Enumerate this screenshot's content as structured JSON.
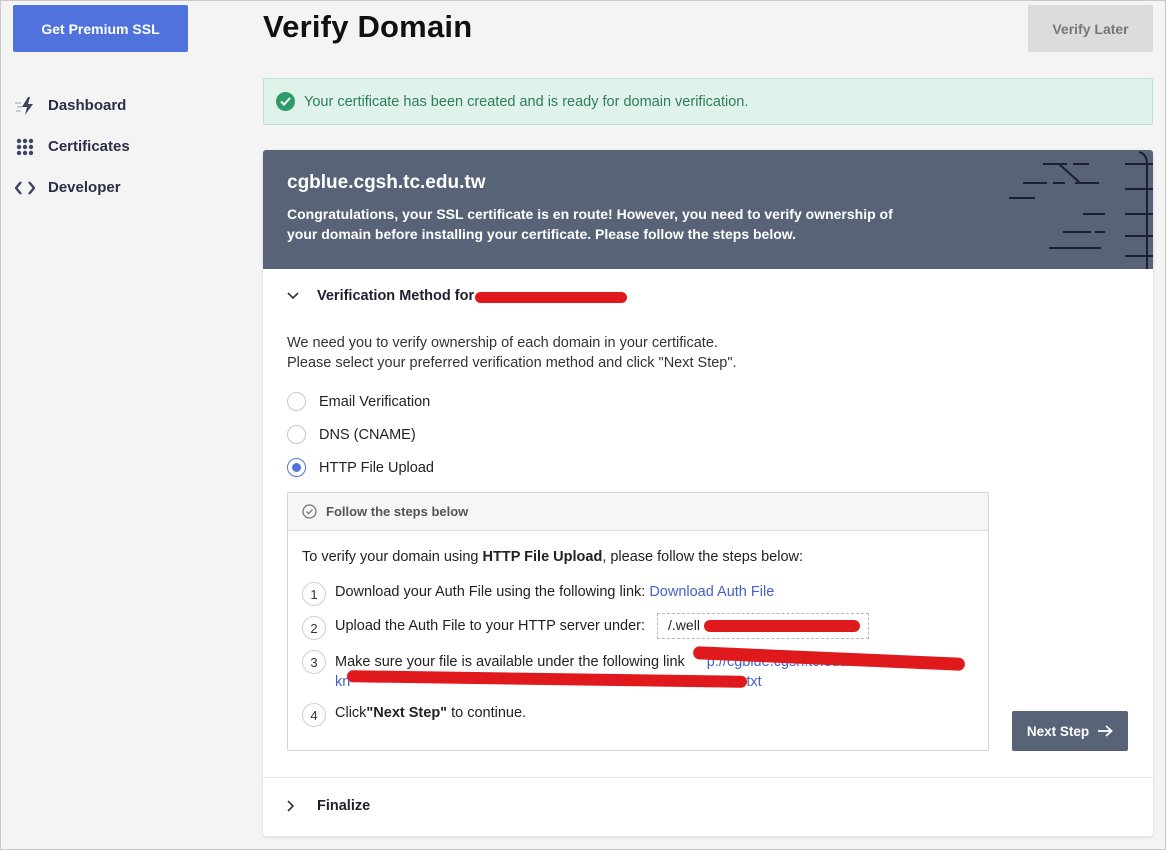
{
  "sidebar": {
    "premium_button": "Get Premium SSL",
    "items": [
      {
        "label": "Dashboard",
        "icon": "bolt-icon"
      },
      {
        "label": "Certificates",
        "icon": "grid-icon"
      },
      {
        "label": "Developer",
        "icon": "code-icon"
      }
    ]
  },
  "header": {
    "title": "Verify Domain",
    "verify_later": "Verify Later"
  },
  "banner": {
    "text": "Your certificate has been created and is ready for domain verification.",
    "color": "#2e7d5b"
  },
  "card": {
    "domain": "cgblue.cgsh.tc.edu.tw",
    "congrats": "Congratulations, your SSL certificate is en route! However, you need to verify ownership of your domain before installing your certificate. Please follow the steps below.",
    "method_section": "Verification Method for",
    "intro_line1": "We need you to verify ownership of each domain in your certificate.",
    "intro_line2": "Please select your preferred verification method and click \"Next Step\".",
    "methods": [
      {
        "label": "Email Verification",
        "selected": false
      },
      {
        "label": "DNS (CNAME)",
        "selected": false
      },
      {
        "label": "HTTP File Upload",
        "selected": true
      }
    ],
    "steps": {
      "header": "Follow the steps below",
      "intro_prefix": "To verify your domain using ",
      "intro_bold": "HTTP File Upload",
      "intro_suffix": ", please follow the steps below:",
      "step1_num": "1",
      "step1_text": "Download your Auth File using the following link: ",
      "step1_link": "Download Auth File",
      "step2_num": "2",
      "step2_text": "Upload the Auth File to your HTTP server under:",
      "step2_path": "/.well",
      "step3_num": "3",
      "step3_text": "Make sure your file is available under the following link",
      "step3_link_line1": "p://cgblue.cgsh.tc.edu",
      "step3_link_line2_start": "kn",
      "step3_link_line2_end": ".txt",
      "step4_num": "4",
      "step4_text_pre": "Click ",
      "step4_bold": "\"Next Step\"",
      "step4_text_post": " to continue."
    },
    "next_button": "Next Step",
    "finalize": "Finalize"
  },
  "colors": {
    "accent": "#4f72dc",
    "header_bg": "#586378",
    "redaction": "#e0191c"
  }
}
